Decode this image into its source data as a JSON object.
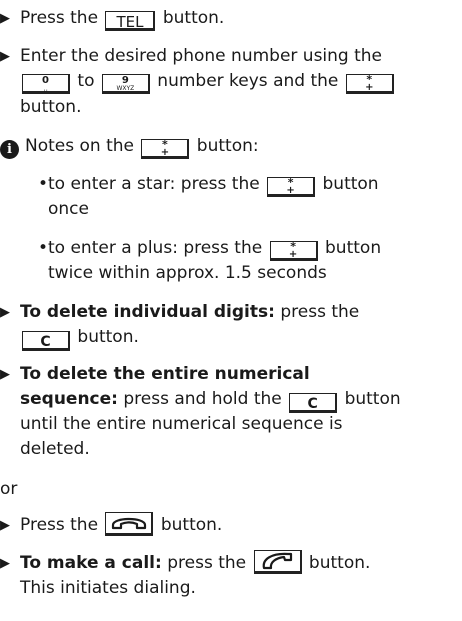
{
  "steps": {
    "s1_pre": "Press the",
    "s1_key": "TEL",
    "s1_post": "button.",
    "s2_line1": "Enter the desired phone number using the",
    "s2_key_from": "0",
    "s2_key_from_sub": "␣",
    "s2_to": "to",
    "s2_key_to": "9",
    "s2_key_to_sub": "WXYZ",
    "s2_mid": "number keys and the",
    "s2_key_star": "*",
    "s2_key_star_sub": "+",
    "s2_line3": "button.",
    "note_pre": "Notes on the",
    "note_post": "button:",
    "note_info": "i",
    "b1_pre": "to enter a star: press the",
    "b1_post": "button",
    "b1_line2": "once",
    "b2_pre": "to enter a plus: press the",
    "b2_post": "button",
    "b2_line2": "twice within approx. 1.5 seconds",
    "d1_bold": "To delete individual digits:",
    "d1_rest": "press the",
    "d1_key": "C",
    "d1_line2": "button.",
    "d2_bold1": "To delete the entire numerical",
    "d2_bold2": "sequence:",
    "d2_rest": "press and hold the",
    "d2_key": "C",
    "d2_post": "button",
    "d2_line3": "until the entire numerical sequence is",
    "d2_line4": "deleted.",
    "or": "or",
    "e1_pre": "Press the",
    "e1_post": "button.",
    "e2_bold": "To make a call:",
    "e2_rest": "press the",
    "e2_post": "button.",
    "e2_line2": "This initiates dialing."
  },
  "icons": {
    "arrow": "▶",
    "bullet": "•",
    "end_call_key": "hang-up-handset-icon",
    "call_key": "handset-icon"
  }
}
